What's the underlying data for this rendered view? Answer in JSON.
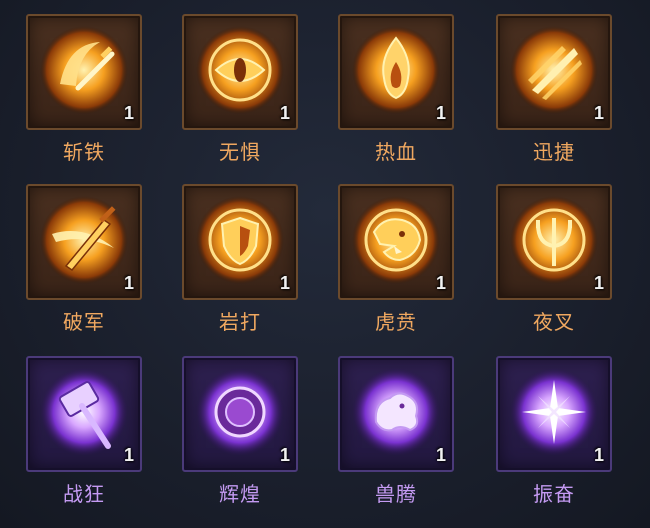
{
  "skills": [
    {
      "name": "斩铁",
      "count": "1",
      "tier": "gold",
      "icon": "slash-blade-icon"
    },
    {
      "name": "无惧",
      "count": "1",
      "tier": "gold",
      "icon": "eye-icon"
    },
    {
      "name": "热血",
      "count": "1",
      "tier": "gold",
      "icon": "flame-icon"
    },
    {
      "name": "迅捷",
      "count": "1",
      "tier": "gold",
      "icon": "speed-streaks-icon"
    },
    {
      "name": "破军",
      "count": "1",
      "tier": "gold",
      "icon": "sword-slash-icon"
    },
    {
      "name": "岩打",
      "count": "1",
      "tier": "gold",
      "icon": "shield-icon"
    },
    {
      "name": "虎贲",
      "count": "1",
      "tier": "gold",
      "icon": "tiger-head-icon"
    },
    {
      "name": "夜叉",
      "count": "1",
      "tier": "gold",
      "icon": "trident-icon"
    },
    {
      "name": "战狂",
      "count": "1",
      "tier": "purple",
      "icon": "war-hammer-icon"
    },
    {
      "name": "辉煌",
      "count": "1",
      "tier": "purple",
      "icon": "radiant-emblem-icon"
    },
    {
      "name": "兽腾",
      "count": "1",
      "tier": "purple",
      "icon": "beast-spirit-icon"
    },
    {
      "name": "振奋",
      "count": "1",
      "tier": "purple",
      "icon": "burst-star-icon"
    }
  ],
  "colors": {
    "gold_label": "#f0a860",
    "purple_label": "#c49af2",
    "gold_frame": "#6b4a2c",
    "purple_frame": "#4b3a7a"
  }
}
